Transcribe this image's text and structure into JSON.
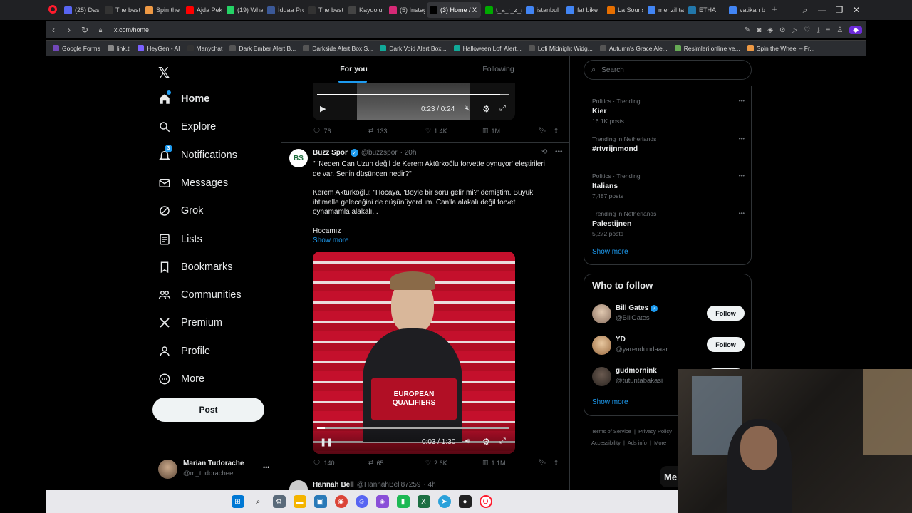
{
  "browser": {
    "tabs": [
      {
        "label": "(25) Dash",
        "color": "#5865f2"
      },
      {
        "label": "The best",
        "color": "#333"
      },
      {
        "label": "Spin the",
        "color": "#e94"
      },
      {
        "label": "Ajda Pekk",
        "color": "#f00"
      },
      {
        "label": "(19) What",
        "color": "#25d366"
      },
      {
        "label": "İddaa Pro",
        "color": "#3b5998"
      },
      {
        "label": "The best",
        "color": "#333"
      },
      {
        "label": "Kaydolun",
        "color": "#444"
      },
      {
        "label": "(5) Instag",
        "color": "#d62976"
      },
      {
        "label": "(3) Home / X",
        "color": "#000"
      },
      {
        "label": "t_a_r_z_a",
        "color": "#0a0"
      },
      {
        "label": "istanbul",
        "color": "#4285f4"
      },
      {
        "label": "fat bike",
        "color": "#4285f4"
      },
      {
        "label": "La Souris",
        "color": "#e76f00"
      },
      {
        "label": "menzil ta",
        "color": "#4285f4"
      },
      {
        "label": "ETHA",
        "color": "#27a"
      },
      {
        "label": "vatikan b",
        "color": "#4285f4"
      }
    ],
    "active_tab_index": 9,
    "new_tab": "+",
    "url": "x.com/home",
    "bookmarks": [
      {
        "label": "Google Forms",
        "color": "#7248b9"
      },
      {
        "label": "link.tl",
        "color": "#888"
      },
      {
        "label": "HeyGen - AI",
        "color": "#7b61ff"
      },
      {
        "label": "Manychat",
        "color": "#333"
      },
      {
        "label": "Dark Ember Alert B...",
        "color": "#555"
      },
      {
        "label": "Darkside Alert Box S...",
        "color": "#555"
      },
      {
        "label": "Dark Void Alert Box...",
        "color": "#1a9"
      },
      {
        "label": "Halloween Lofi Alert...",
        "color": "#1a9"
      },
      {
        "label": "Lofi Midnight Widg...",
        "color": "#555"
      },
      {
        "label": "Autumn's Grace Ale...",
        "color": "#555"
      },
      {
        "label": "Resimleri online ve...",
        "color": "#6a5"
      },
      {
        "label": "Spin the Wheel – Fr...",
        "color": "#e94"
      }
    ]
  },
  "sidebar": {
    "logo": "X",
    "items": [
      {
        "label": "Home",
        "icon": "home-icon"
      },
      {
        "label": "Explore",
        "icon": "search-icon"
      },
      {
        "label": "Notifications",
        "icon": "bell-icon"
      },
      {
        "label": "Messages",
        "icon": "mail-icon"
      },
      {
        "label": "Grok",
        "icon": "grok-icon"
      },
      {
        "label": "Lists",
        "icon": "list-icon"
      },
      {
        "label": "Bookmarks",
        "icon": "bookmark-icon"
      },
      {
        "label": "Communities",
        "icon": "people-icon"
      },
      {
        "label": "Premium",
        "icon": "x-icon"
      },
      {
        "label": "Profile",
        "icon": "person-icon"
      },
      {
        "label": "More",
        "icon": "more-icon"
      }
    ],
    "notif_badge": "3",
    "post_label": "Post",
    "account": {
      "name": "Marian Tudorache",
      "handle": "@m_tudorachee",
      "menu": "•••"
    }
  },
  "feed": {
    "tabs": {
      "for_you": "For you",
      "following": "Following"
    },
    "video1": {
      "time": "0:23 / 0:24",
      "progress": 0.95
    },
    "actions1": {
      "replies": "76",
      "reposts": "133",
      "likes": "1.4K",
      "views": "1M"
    },
    "tweet": {
      "author": "Buzz Spor",
      "avatar_text": "BS",
      "handle": "@buzzspor",
      "time": "· 20h",
      "line1": "\" 'Neden Can Uzun değil de Kerem Aktürkoğlu forvette oynuyor' eleştirileri",
      "line2": "de var. Senin düşüncen nedir?\"",
      "line3": "Kerem Aktürkoğlu: \"Hocaya, 'Böyle bir soru gelir mi?' demiştim. Büyük",
      "line4": "ihtimalle geleceğini de düşünüyordum. Can'la alakalı değil forvet",
      "line5": "oynamamla alakalı...",
      "line6": "Hocamız",
      "show_more": "Show more",
      "video": {
        "time": "0:03 / 1:30",
        "podium_line1": "EUROPEAN",
        "podium_line2": "QUALIFIERS",
        "progress": 0.04
      }
    },
    "actions2": {
      "replies": "140",
      "reposts": "65",
      "likes": "2.6K",
      "views": "1.1M"
    },
    "next_tweet": {
      "author": "Hannah Bell",
      "handle": "@HannahBell87259",
      "time": "· 4h"
    }
  },
  "right": {
    "search_placeholder": "Search",
    "trends": [
      {
        "category": "Politics · Trending",
        "title": "Kier",
        "count": "16.1K posts"
      },
      {
        "category": "Trending in Netherlands",
        "title": "#rtvrijnmond",
        "count": ""
      },
      {
        "category": "Politics · Trending",
        "title": "Italians",
        "count": "7,487 posts"
      },
      {
        "category": "Trending in Netherlands",
        "title": "Palestijnen",
        "count": "5,272 posts"
      }
    ],
    "show_more": "Show more",
    "who_to_follow": {
      "title": "Who to follow",
      "users": [
        {
          "name": "Bill Gates",
          "handle": "@BillGates",
          "verified": true
        },
        {
          "name": "YD",
          "handle": "@yarendundaaar",
          "verified": false
        },
        {
          "name": "gudmornink",
          "handle": "@tutuntabakasi",
          "verified": false
        }
      ],
      "follow_label": "Follow",
      "show_more": "Show more"
    },
    "footer": [
      "Terms of Service",
      "Privacy Policy",
      "Accessibility",
      "Ads info",
      "More"
    ],
    "messages_label": "Me"
  }
}
